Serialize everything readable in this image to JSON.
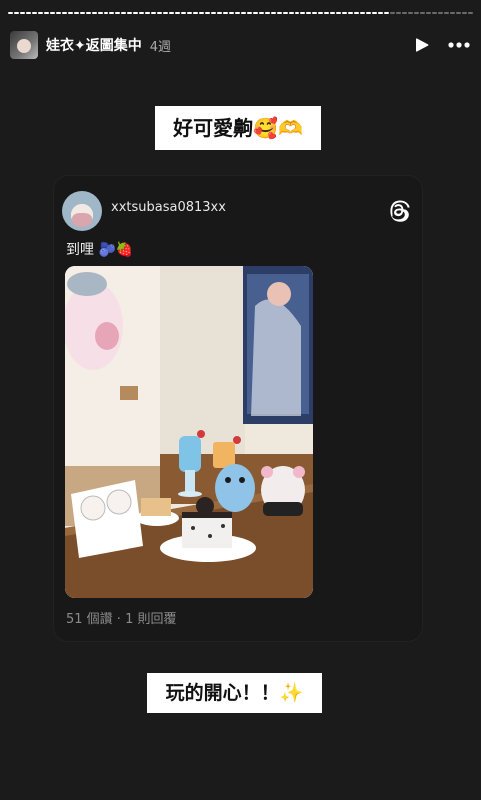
{
  "story": {
    "progress_segments": [
      1.0,
      1.0,
      1.0,
      1.0,
      1.0,
      1.0,
      1.0,
      1.0,
      1.0,
      1.0,
      1.0,
      1.0,
      1.0,
      1.0,
      1.0,
      1.0,
      1.0,
      1.0,
      1.0,
      1.0,
      1.0,
      1.0,
      1.0,
      1.0,
      1.0,
      1.0,
      1.0,
      1.0,
      1.0,
      1.0,
      1.0,
      1.0,
      1.0,
      1.0,
      1.0,
      1.0,
      1.0,
      1.0,
      1.0,
      1.0,
      1.0,
      1.0,
      1.0,
      1.0,
      1.0,
      1.0,
      1.0,
      1.0,
      1.0,
      1.0,
      1.0,
      1.0,
      1.0,
      1.0,
      1.0,
      1.0,
      1.0,
      1.0,
      1.0,
      1.0,
      1.0,
      1.0,
      1.0,
      1.0,
      0.0,
      0.0,
      0.0,
      0.0,
      0.0,
      0.0,
      0.0,
      0.0,
      0.0,
      0.0,
      0.0,
      0.0,
      0.0,
      0.0
    ],
    "title": "娃衣✦返圖集中",
    "age": "4週"
  },
  "stickers": {
    "top": "好可愛齁🥰🫶",
    "bottom": "玩的開心！！✨"
  },
  "post": {
    "username": "xxtsubasa0813xx",
    "text": "到哩 🫐🍓",
    "stats": "51 個讚 · 1 則回覆"
  },
  "icons": {
    "play": "play-icon",
    "more": "more-icon",
    "threads": "threads-logo-icon"
  },
  "colors": {
    "background": "#1b1b1b",
    "card": "#181818",
    "sticker_bg": "#ffffff"
  }
}
